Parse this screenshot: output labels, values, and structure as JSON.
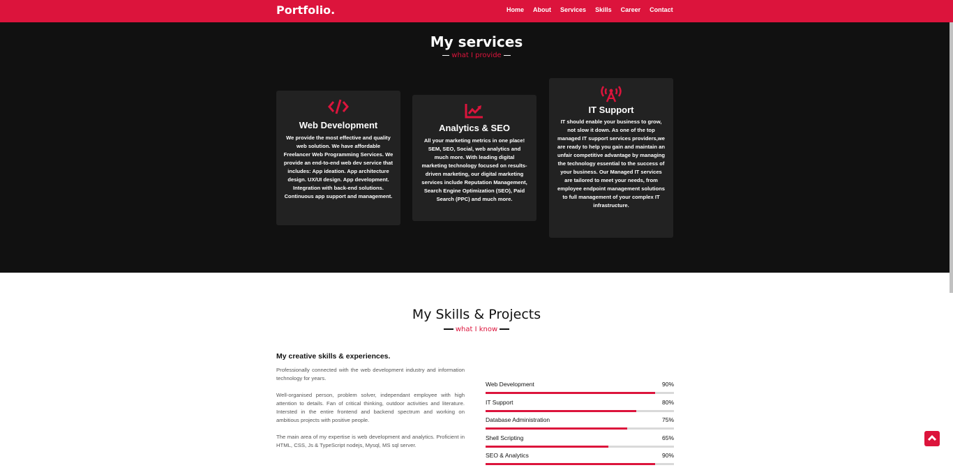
{
  "nav": {
    "logo": "Portfolio.",
    "items": [
      {
        "label": "Home"
      },
      {
        "label": "About"
      },
      {
        "label": "Services"
      },
      {
        "label": "Skills"
      },
      {
        "label": "Career"
      },
      {
        "label": "Contact"
      }
    ]
  },
  "colors": {
    "accent": "#dc143c",
    "dark_bg": "#111111",
    "card_bg": "#222222"
  },
  "services": {
    "title": "My services",
    "subtitle": "what I provide",
    "cards": [
      {
        "icon": "code-icon",
        "title": "Web Development",
        "text": "We provide the most effective and quality web solution. We have affordable Freelancer Web Programming Services. We provide an end-to-end web dev service that includes: App ideation. App architecture design. UX/UI design. App development. Integration with back-end solutions. Continuous app support and management."
      },
      {
        "icon": "chart-line-icon",
        "title": "Analytics & SEO",
        "text": "All your marketing metrics in one place! SEM, SEO, Social, web analytics and much more. With leading digital marketing technology focused on results-driven marketing, our digital marketing services include Reputation Management, Search Engine Optimization (SEO), Paid Search (PPC) and much more."
      },
      {
        "icon": "broadcast-tower-icon",
        "title": "IT Support",
        "text": "IT should enable your business to grow, not slow it down. As one of the top managed IT support services providers,we are ready to help you gain and maintain an unfair competitive advantage by managing the technology essential to the success of your business. Our Managed IT services are tailored to meet your needs, from employee endpoint management solutions to full management of your complex IT infrastructure."
      }
    ]
  },
  "skills": {
    "title": "My Skills & Projects",
    "subtitle": "what I know",
    "heading": "My creative skills & experiences.",
    "paragraphs": [
      "Professionally connected with the web development industry and information technology for years.",
      "Well-organised person, problem solver, independant employee with high attention to details. Fan of critical thinking, outdoor activities and literature. Intersted in the entire frontend and backend spectrum and working on ambitious projects with positive people.",
      "The main area of my expertise is web development and analytics. Proficient in HTML, CSS, Js & TypeScript nodejs, Mysql, MS sql server."
    ],
    "bars": [
      {
        "label": "Web Development",
        "percent_text": "90%",
        "value": 90
      },
      {
        "label": "IT Support",
        "percent_text": "80%",
        "value": 80
      },
      {
        "label": "Database Administration",
        "percent_text": "75%",
        "value": 75
      },
      {
        "label": "Shell Scripting",
        "percent_text": "65%",
        "value": 65
      },
      {
        "label": "SEO & Analytics",
        "percent_text": "90%",
        "value": 90
      }
    ]
  },
  "back_to_top_icon": "chevron-up-icon"
}
